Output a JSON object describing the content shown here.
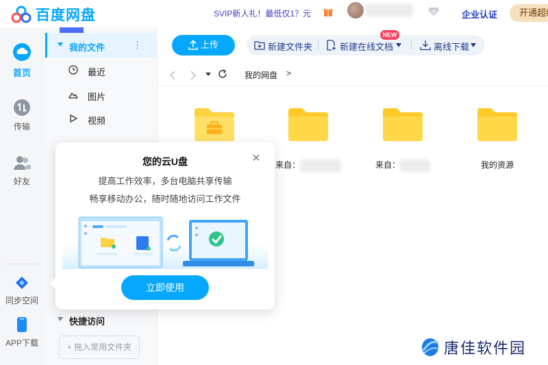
{
  "header": {
    "app_name": "百度网盘",
    "svip_promo": "SVIP新人礼！最低仅1？元",
    "enterprise_label": "企业认证",
    "open_vip_label": "开通超级"
  },
  "rail": {
    "items": [
      {
        "label": "首页",
        "icon": "cloud-home-icon"
      },
      {
        "label": "传输",
        "icon": "transfer-icon"
      },
      {
        "label": "好友",
        "icon": "friends-icon"
      },
      {
        "label": "同步空间",
        "icon": "sync-space-icon"
      },
      {
        "label": "APP下载",
        "icon": "phone-icon"
      }
    ]
  },
  "nav": {
    "my_files": "我的文件",
    "items": [
      {
        "label": "最近",
        "icon": "clock-icon"
      },
      {
        "label": "图片",
        "icon": "image-icon"
      },
      {
        "label": "视频",
        "icon": "video-icon"
      }
    ],
    "quick_access": "快捷访问",
    "drop_hint": "+ 拖入常用文件夹"
  },
  "toolbar": {
    "upload": "上传",
    "new_folder": "新建文件夹",
    "new_doc": "新建在线文档",
    "new_badge": "NEW",
    "offline_download": "离线下载"
  },
  "breadcrumb": {
    "current": "我的网盘",
    "arrow": ">"
  },
  "files": [
    {
      "name": "",
      "type": "toolbox-folder"
    },
    {
      "name": "来自：",
      "type": "folder"
    },
    {
      "name": "来自：",
      "type": "folder"
    },
    {
      "name": "我的资源",
      "type": "folder"
    }
  ],
  "popup": {
    "title": "您的云U盘",
    "line1": "提高工作效率，多台电脑共享传输",
    "line2": "畅享移动办公，随时随地访问工作文件",
    "cta": "立即使用",
    "close": "×"
  },
  "watermark": {
    "text": "唐佳软件园"
  },
  "colors": {
    "accent": "#06a7ff",
    "folder": "#ffd23f",
    "badge": "#ff3d5e"
  }
}
